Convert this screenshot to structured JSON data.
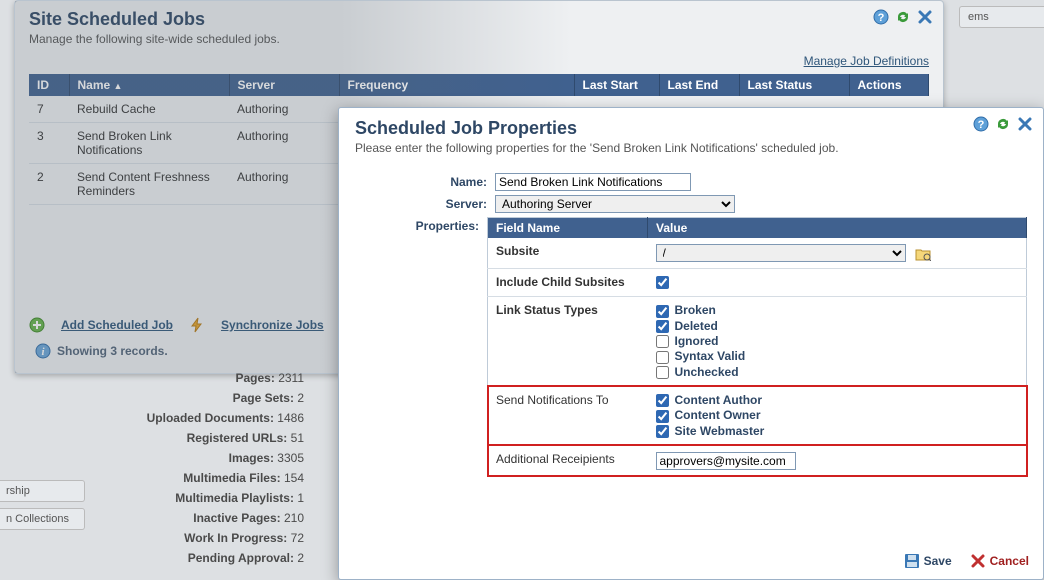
{
  "bg": {
    "title": "Site Scheduled Jobs",
    "subtitle": "Manage the following site-wide scheduled jobs.",
    "manage_link": "Manage Job Definitions",
    "right_tab": "ems",
    "cols": {
      "id": "ID",
      "name": "Name",
      "server": "Server",
      "freq": "Frequency",
      "last_start": "Last Start",
      "last_end": "Last End",
      "last_status": "Last Status",
      "actions": "Actions"
    },
    "rows": [
      {
        "id": "7",
        "name": "Rebuild Cache",
        "server": "Authoring"
      },
      {
        "id": "3",
        "name": "Send Broken Link Notifications",
        "server": "Authoring"
      },
      {
        "id": "2",
        "name": "Send Content Freshness Reminders",
        "server": "Authoring"
      }
    ],
    "add_link": "Add Scheduled Job",
    "sync_link": "Synchronize Jobs",
    "showing": "Showing 3 records."
  },
  "stats": [
    {
      "k": "Pages:",
      "v": "2311"
    },
    {
      "k": "Page Sets:",
      "v": "2"
    },
    {
      "k": "Uploaded Documents:",
      "v": "1486"
    },
    {
      "k": "Registered URLs:",
      "v": "51"
    },
    {
      "k": "Images:",
      "v": "3305"
    },
    {
      "k": "Multimedia Files:",
      "v": "154"
    },
    {
      "k": "Multimedia Playlists:",
      "v": "1"
    },
    {
      "k": "Inactive Pages:",
      "v": "210"
    },
    {
      "k": "Work In Progress:",
      "v": "72"
    },
    {
      "k": "Pending Approval:",
      "v": "2"
    }
  ],
  "left_frags": [
    "rship",
    "n Collections"
  ],
  "modal": {
    "title": "Scheduled Job Properties",
    "subtitle": "Please enter the following properties for the 'Send Broken Link Notifications' scheduled job.",
    "labels": {
      "name": "Name:",
      "server": "Server:",
      "properties": "Properties:"
    },
    "name_value": "Send Broken Link Notifications",
    "server_value": "Authoring Server",
    "prop_cols": {
      "field": "Field Name",
      "value": "Value"
    },
    "props": {
      "subsite": {
        "label": "Subsite",
        "value": "/"
      },
      "include_child": {
        "label": "Include Child Subsites",
        "checked": true
      },
      "link_status": {
        "label": "Link Status Types",
        "opts": [
          {
            "label": "Broken",
            "checked": true
          },
          {
            "label": "Deleted",
            "checked": true
          },
          {
            "label": "Ignored",
            "checked": false
          },
          {
            "label": "Syntax Valid",
            "checked": false
          },
          {
            "label": "Unchecked",
            "checked": false
          }
        ]
      },
      "send_to": {
        "label": "Send Notifications To",
        "opts": [
          {
            "label": "Content Author",
            "checked": true
          },
          {
            "label": "Content Owner",
            "checked": true
          },
          {
            "label": "Site Webmaster",
            "checked": true
          }
        ]
      },
      "additional": {
        "label": "Additional Receipients",
        "value": "approvers@mysite.com"
      }
    },
    "buttons": {
      "save": "Save",
      "cancel": "Cancel"
    }
  }
}
